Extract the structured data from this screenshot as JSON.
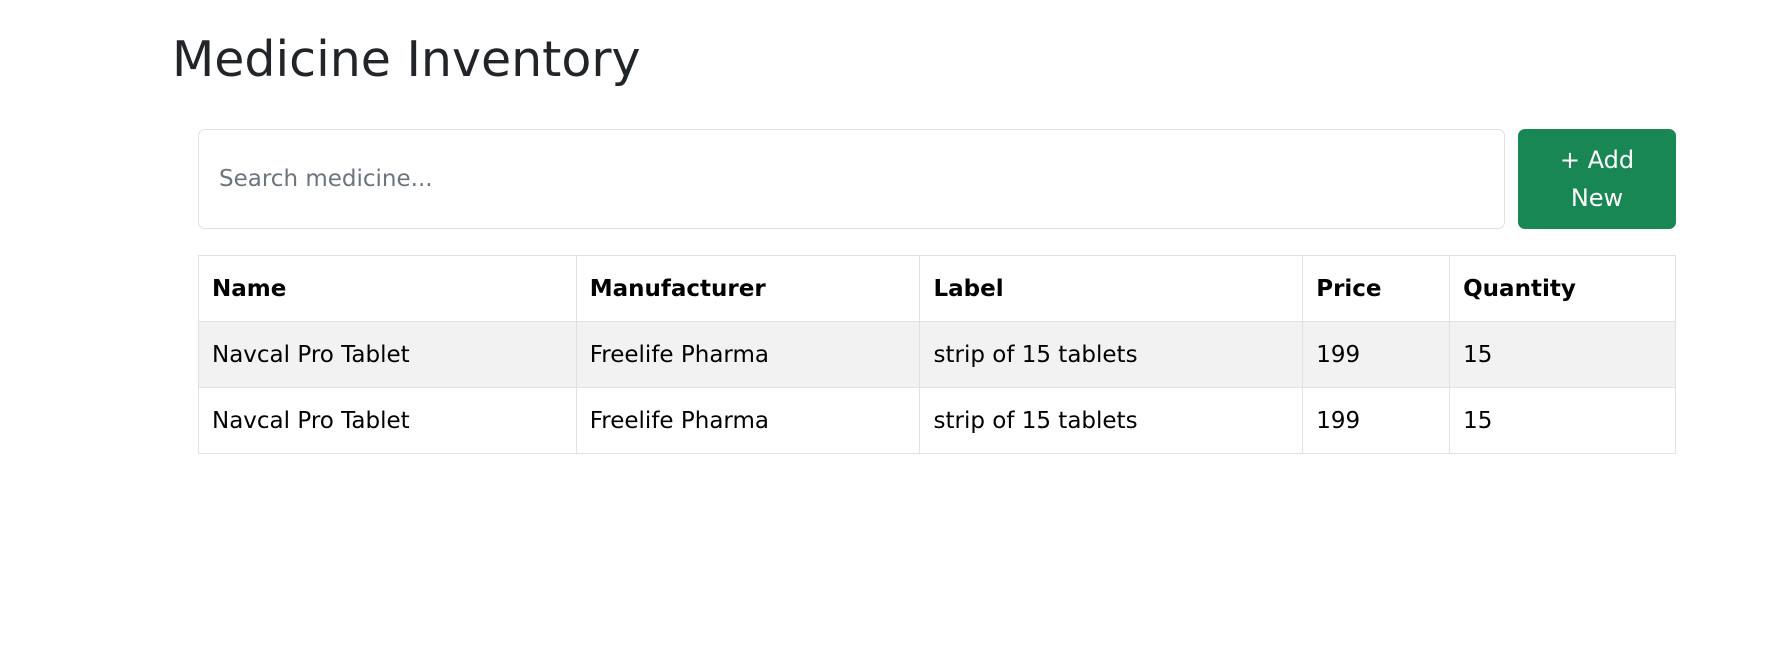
{
  "page": {
    "title": "Medicine Inventory"
  },
  "search": {
    "placeholder": "Search medicine...",
    "value": ""
  },
  "toolbar": {
    "add_label": "+ Add New"
  },
  "colors": {
    "add_button_bg": "#198754",
    "striped_row_bg": "#f2f2f2"
  },
  "table": {
    "headers": {
      "name": "Name",
      "manufacturer": "Manufacturer",
      "label": "Label",
      "price": "Price",
      "quantity": "Quantity"
    },
    "rows": [
      {
        "name": "Navcal Pro Tablet",
        "manufacturer": "Freelife Pharma",
        "label": "strip of 15 tablets",
        "price": "199",
        "quantity": "15"
      },
      {
        "name": "Navcal Pro Tablet",
        "manufacturer": "Freelife Pharma",
        "label": "strip of 15 tablets",
        "price": "199",
        "quantity": "15"
      }
    ]
  }
}
